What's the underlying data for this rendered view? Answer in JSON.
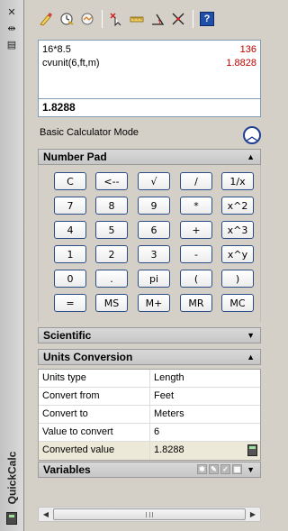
{
  "app": {
    "title": "QuickCalc"
  },
  "toolbar": {
    "icons": [
      "clear-icon",
      "clear-history-icon",
      "get-coordinates-icon",
      "distance-icon",
      "angle-icon",
      "intersection-icon",
      "help-icon"
    ],
    "help_label": "?"
  },
  "history": [
    {
      "expr": "16*8.5",
      "result": "136"
    },
    {
      "expr": "cvunit(6,ft,m)",
      "result": "1.8828"
    }
  ],
  "input": {
    "value": "1.8288"
  },
  "mode_label": "Basic Calculator Mode",
  "sections": {
    "number_pad": "Number Pad",
    "scientific": "Scientific",
    "units_conversion": "Units Conversion",
    "variables": "Variables"
  },
  "keys": [
    [
      "C",
      "<--",
      "√",
      "/",
      "1/x"
    ],
    [
      "7",
      "8",
      "9",
      "*",
      "x^2"
    ],
    [
      "4",
      "5",
      "6",
      "+",
      "x^3"
    ],
    [
      "1",
      "2",
      "3",
      "-",
      "x^y"
    ],
    [
      "0",
      ".",
      "pi",
      "(",
      ")"
    ],
    [
      "=",
      "MS",
      "M+",
      "MR",
      "MC"
    ]
  ],
  "units": [
    {
      "label": "Units type",
      "value": "Length"
    },
    {
      "label": "Convert from",
      "value": "Feet"
    },
    {
      "label": "Convert to",
      "value": "Meters"
    },
    {
      "label": "Value to convert",
      "value": "6"
    },
    {
      "label": "Converted value",
      "value": "1.8288"
    }
  ],
  "colors": {
    "result_text": "#c00000",
    "key_border": "#2b4d86",
    "background": "#d4d0c8"
  }
}
